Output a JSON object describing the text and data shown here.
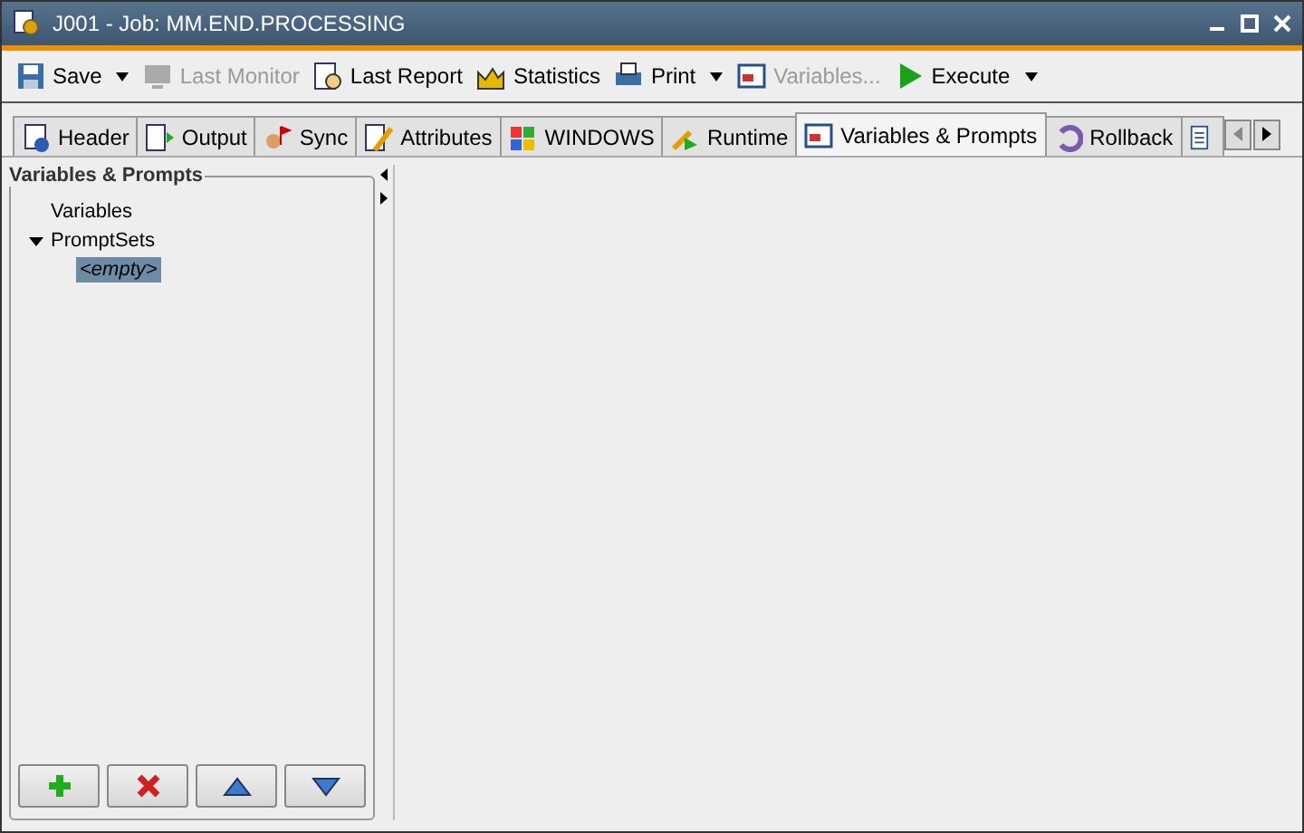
{
  "window": {
    "title": "J001 - Job: MM.END.PROCESSING"
  },
  "toolbar": [
    {
      "label": "Save",
      "disabled": false,
      "menu": true
    },
    {
      "label": "Last Monitor",
      "disabled": true,
      "menu": false
    },
    {
      "label": "Last Report",
      "disabled": false,
      "menu": false
    },
    {
      "label": "Statistics",
      "disabled": false,
      "menu": false
    },
    {
      "label": "Print",
      "disabled": false,
      "menu": true
    },
    {
      "label": "Variables...",
      "disabled": true,
      "menu": false
    },
    {
      "label": "Execute",
      "disabled": false,
      "menu": true
    }
  ],
  "tabs": [
    {
      "label": "Header",
      "selected": false
    },
    {
      "label": "Output",
      "selected": false
    },
    {
      "label": "Sync",
      "selected": false
    },
    {
      "label": "Attributes",
      "selected": false
    },
    {
      "label": "WINDOWS",
      "selected": false
    },
    {
      "label": "Runtime",
      "selected": false
    },
    {
      "label": "Variables & Prompts",
      "selected": true
    },
    {
      "label": "Rollback",
      "selected": false
    }
  ],
  "panel": {
    "title": "Variables & Prompts",
    "tree": [
      {
        "label": "Variables",
        "selected": false
      },
      {
        "label": "PromptSets",
        "selected": false,
        "expanded": true,
        "children": [
          {
            "label": "<empty>",
            "selected": true
          }
        ]
      }
    ]
  }
}
